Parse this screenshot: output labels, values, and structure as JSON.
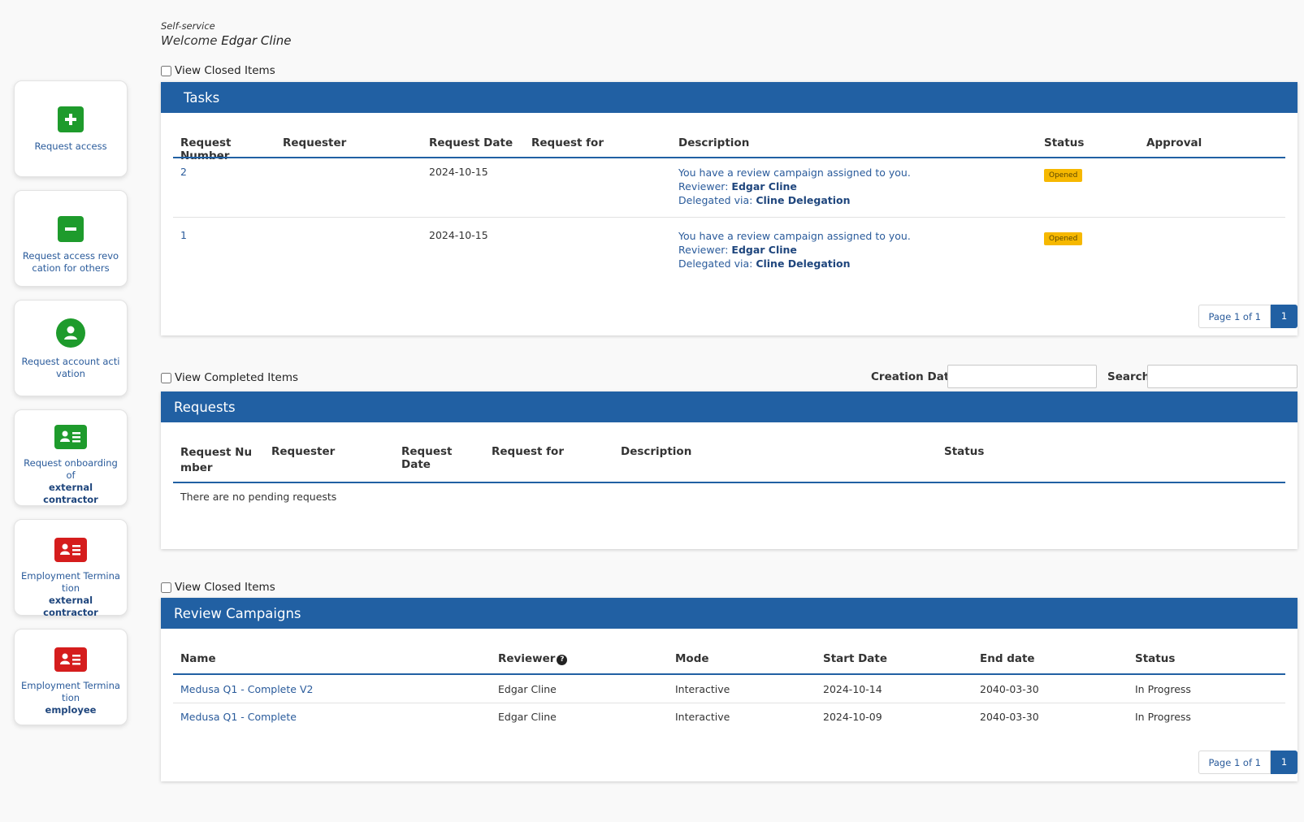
{
  "header": {
    "self_service": "Self-service",
    "welcome": "Welcome",
    "user": "Edgar Cline"
  },
  "sidebar": {
    "items": [
      {
        "label": "Request access",
        "sub": "",
        "icon": "plus-icon"
      },
      {
        "label": "Request access revocation for others",
        "sub": "",
        "icon": "minus-icon"
      },
      {
        "label": "Request account activation",
        "sub": "",
        "icon": "user-circle-icon"
      },
      {
        "label": "Request onboarding of",
        "sub": "external contractor",
        "icon": "id-card-icon"
      },
      {
        "label": "Employment Termination",
        "sub": "external contractor",
        "icon": "id-card-icon"
      },
      {
        "label": "Employment Termination",
        "sub": "employee",
        "icon": "id-card-icon"
      }
    ]
  },
  "tasks": {
    "view_closed": "View Closed Items",
    "title": "Tasks",
    "columns": [
      "Request Number",
      "Requester",
      "Request Date",
      "Request for",
      "Description",
      "Status",
      "Approval"
    ],
    "rows": [
      {
        "number": "2",
        "requester": "",
        "date": "2024-10-15",
        "for": "",
        "desc": "You have a review campaign assigned to you.",
        "reviewer_label": "Reviewer:",
        "reviewer": "Edgar Cline",
        "delegated_label": "Delegated via:",
        "delegated": "Cline Delegation",
        "status": "Opened"
      },
      {
        "number": "1",
        "requester": "",
        "date": "2024-10-15",
        "for": "",
        "desc": "You have a review campaign assigned to you.",
        "reviewer_label": "Reviewer:",
        "reviewer": "Edgar Cline",
        "delegated_label": "Delegated via:",
        "delegated": "Cline Delegation",
        "status": "Opened"
      }
    ],
    "pager": {
      "info": "Page 1 of 1",
      "page": "1"
    }
  },
  "requests": {
    "view_completed": "View Completed Items",
    "creation_date_label": "Creation Date:",
    "search_label": "Search:",
    "creation_date_value": "",
    "search_value": "",
    "title": "Requests",
    "columns": [
      "Request Number",
      "Requester",
      "Request Date",
      "Request for",
      "Description",
      "Status"
    ],
    "empty": "There are no pending requests"
  },
  "campaigns": {
    "view_closed": "View Closed Items",
    "title": "Review Campaigns",
    "columns": [
      "Name",
      "Reviewer",
      "Mode",
      "Start Date",
      "End date",
      "Status"
    ],
    "rows": [
      {
        "name": "Medusa Q1 - Complete V2",
        "reviewer": "Edgar Cline",
        "mode": "Interactive",
        "start": "2024-10-14",
        "end": "2040-03-30",
        "status": "In Progress"
      },
      {
        "name": "Medusa Q1 - Complete",
        "reviewer": "Edgar Cline",
        "mode": "Interactive",
        "start": "2024-10-09",
        "end": "2040-03-30",
        "status": "In Progress"
      }
    ],
    "pager": {
      "info": "Page 1 of 1",
      "page": "1"
    }
  },
  "colors": {
    "primary": "#2160a3",
    "link": "#2a5b9b",
    "green": "#1e9b2c",
    "red": "#d51d1d",
    "badge": "#f6b800"
  }
}
